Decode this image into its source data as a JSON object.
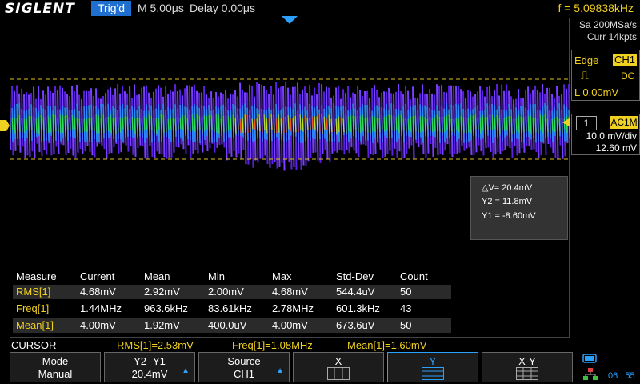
{
  "header": {
    "logo": "SIGLENT",
    "trigger_status": "Trig'd",
    "timebase": "M 5.00μs",
    "delay": "Delay 0.00μs",
    "frequency": "f = 5.09838kHz"
  },
  "acquisition": {
    "sample_rate": "Sa 200MSa/s",
    "memory": "Curr 14kpts"
  },
  "trigger": {
    "type": "Edge",
    "source": "CH1",
    "slope_icon": "falling-edge-icon",
    "coupling": "DC",
    "level": "L  0.00mV"
  },
  "channel": {
    "number": "1",
    "coupling": "AC1M",
    "scale": "10.0 mV/div",
    "offset": "12.60 mV"
  },
  "cursor_info": {
    "delta_v": "△V= 20.4mV",
    "y2": "Y2 = 11.8mV",
    "y1": "Y1 = -8.60mV"
  },
  "measurements": {
    "headers": [
      "Measure",
      "Current",
      "Mean",
      "Min",
      "Max",
      "Std-Dev",
      "Count"
    ],
    "rows": [
      [
        "RMS[1]",
        "4.68mV",
        "2.92mV",
        "2.00mV",
        "4.68mV",
        "544.4uV",
        "50"
      ],
      [
        "Freq[1]",
        "1.44MHz",
        "963.6kHz",
        "83.61kHz",
        "2.78MHz",
        "601.3kHz",
        "43"
      ],
      [
        "Mean[1]",
        "4.00mV",
        "1.92mV",
        "400.0uV",
        "4.00mV",
        "673.6uV",
        "50"
      ]
    ]
  },
  "status": {
    "menu": "CURSOR",
    "m1": "RMS[1]=2.53mV",
    "m2": "Freq[1]=1.08MHz",
    "m3": "Mean[1]=1.60mV",
    "time": "06 : 55"
  },
  "softkeys": {
    "mode_label": "Mode",
    "mode_value": "Manual",
    "y_label": "Y2 -Y1",
    "y_value": "20.4mV",
    "source_label": "Source",
    "source_value": "CH1",
    "x_label": "X",
    "y_sel_label": "Y",
    "xy_label": "X-Y"
  },
  "colors": {
    "accent": "#f0d020",
    "trig_blue": "#1f6fd0",
    "wave_purple": "#6a2cff",
    "wave_green": "#30e050"
  }
}
